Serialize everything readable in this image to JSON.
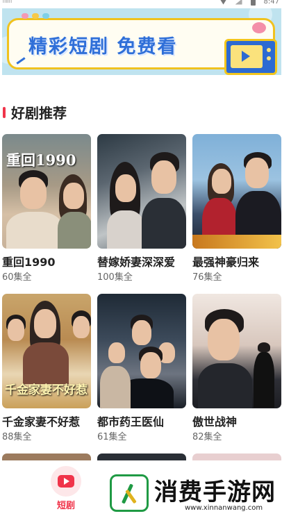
{
  "status_bar": {
    "left_text": "ᗰᗰ",
    "time": "8:47"
  },
  "banner": {
    "title": "精彩短剧 免费看",
    "icon": "tv-play-icon",
    "bg_color": "#bfe3ef",
    "title_color": "#2f6fd8"
  },
  "section": {
    "title": "好剧推荐",
    "accent_color": "#f0344a"
  },
  "dramas": [
    {
      "title": "重回1990",
      "episodes": "60集全",
      "poster_text": "重回1990"
    },
    {
      "title": "替嫁娇妻深深爱",
      "episodes": "100集全",
      "poster_text": ""
    },
    {
      "title": "最强神豪归来",
      "episodes": "76集全",
      "poster_text": ""
    },
    {
      "title": "千金家妻不好惹",
      "episodes": "88集全",
      "poster_text": "千金家妻不好惹"
    },
    {
      "title": "都市药王医仙",
      "episodes": "61集全",
      "poster_text": ""
    },
    {
      "title": "傲世战神",
      "episodes": "82集全",
      "poster_text": ""
    }
  ],
  "tabbar": {
    "active_tab": {
      "label": "短剧",
      "icon": "tv-play-icon",
      "color": "#f0344a"
    }
  },
  "watermark": {
    "name": "消费手游网",
    "url": "www.xinnanwang.com"
  }
}
